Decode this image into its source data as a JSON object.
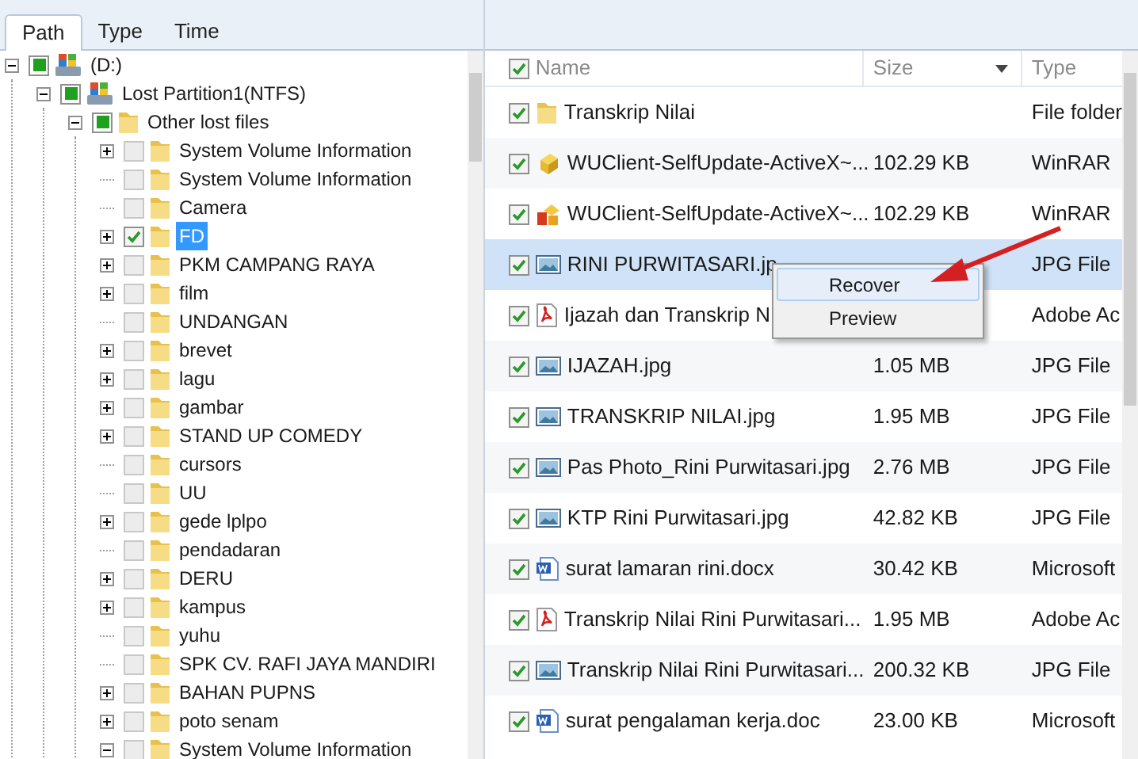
{
  "tabs": [
    {
      "label": "Path",
      "selected": true
    },
    {
      "label": "Type",
      "selected": false
    },
    {
      "label": "Time",
      "selected": false
    }
  ],
  "tree": [
    {
      "label": "(D:)",
      "kind": "drive",
      "expandable": true,
      "expanded": true,
      "partial": true,
      "selected": false,
      "children": [
        {
          "label": "Lost Partition1(NTFS)",
          "kind": "drive",
          "expandable": true,
          "expanded": true,
          "partial": true,
          "selected": false,
          "children": [
            {
              "label": "Other lost files",
              "kind": "folder",
              "expandable": true,
              "expanded": true,
              "partial": true,
              "selected": false,
              "children": [
                {
                  "label": "System Volume Information",
                  "kind": "folder",
                  "expandable": true,
                  "expanded": false,
                  "checked": false,
                  "selected": false
                },
                {
                  "label": "System Volume Information",
                  "kind": "folder",
                  "expandable": false,
                  "checked": false,
                  "selected": false
                },
                {
                  "label": "Camera",
                  "kind": "folder",
                  "expandable": false,
                  "checked": false,
                  "selected": false
                },
                {
                  "label": "FD",
                  "kind": "folder",
                  "expandable": true,
                  "expanded": false,
                  "checked": true,
                  "selected": true
                },
                {
                  "label": "PKM CAMPANG RAYA",
                  "kind": "folder",
                  "expandable": true,
                  "expanded": false,
                  "checked": false,
                  "selected": false
                },
                {
                  "label": "film",
                  "kind": "folder",
                  "expandable": true,
                  "expanded": false,
                  "checked": false,
                  "selected": false
                },
                {
                  "label": "UNDANGAN",
                  "kind": "folder",
                  "expandable": false,
                  "checked": false,
                  "selected": false
                },
                {
                  "label": "brevet",
                  "kind": "folder",
                  "expandable": true,
                  "expanded": false,
                  "checked": false,
                  "selected": false
                },
                {
                  "label": "lagu",
                  "kind": "folder",
                  "expandable": true,
                  "expanded": false,
                  "checked": false,
                  "selected": false
                },
                {
                  "label": "gambar",
                  "kind": "folder",
                  "expandable": true,
                  "expanded": false,
                  "checked": false,
                  "selected": false
                },
                {
                  "label": "STAND UP COMEDY",
                  "kind": "folder",
                  "expandable": true,
                  "expanded": false,
                  "checked": false,
                  "selected": false
                },
                {
                  "label": "cursors",
                  "kind": "folder",
                  "expandable": false,
                  "checked": false,
                  "selected": false
                },
                {
                  "label": "UU",
                  "kind": "folder",
                  "expandable": false,
                  "checked": false,
                  "selected": false
                },
                {
                  "label": "gede lplpo",
                  "kind": "folder",
                  "expandable": true,
                  "expanded": false,
                  "checked": false,
                  "selected": false
                },
                {
                  "label": "pendadaran",
                  "kind": "folder",
                  "expandable": false,
                  "checked": false,
                  "selected": false
                },
                {
                  "label": "DERU",
                  "kind": "folder",
                  "expandable": true,
                  "expanded": false,
                  "checked": false,
                  "selected": false
                },
                {
                  "label": "kampus",
                  "kind": "folder",
                  "expandable": true,
                  "expanded": false,
                  "checked": false,
                  "selected": false
                },
                {
                  "label": "yuhu",
                  "kind": "folder",
                  "expandable": false,
                  "checked": false,
                  "selected": false
                },
                {
                  "label": "SPK CV. RAFI JAYA MANDIRI",
                  "kind": "folder",
                  "expandable": false,
                  "checked": false,
                  "selected": false
                },
                {
                  "label": "BAHAN PUPNS",
                  "kind": "folder",
                  "expandable": true,
                  "expanded": false,
                  "checked": false,
                  "selected": false
                },
                {
                  "label": "poto senam",
                  "kind": "folder",
                  "expandable": true,
                  "expanded": false,
                  "checked": false,
                  "selected": false
                },
                {
                  "label": "System Volume Information",
                  "kind": "folder",
                  "expandable": true,
                  "expanded": true,
                  "checked": false,
                  "selected": false
                }
              ]
            }
          ]
        }
      ]
    }
  ],
  "table": {
    "header_checked": true,
    "columns": [
      "Name",
      "Size",
      "Type"
    ],
    "rows": [
      {
        "name": "Transkrip Nilai",
        "type": "File folder",
        "kind": "folder",
        "checked": true,
        "selected": false
      },
      {
        "name": "WUClient-SelfUpdate-ActiveX~...",
        "size": "102.29 KB",
        "type": "WinRAR",
        "kind": "package",
        "checked": true,
        "selected": false
      },
      {
        "name": "WUClient-SelfUpdate-ActiveX~...",
        "size": "102.29 KB",
        "type": "WinRAR",
        "kind": "installer",
        "checked": true,
        "selected": false
      },
      {
        "name": "RINI PURWITASARI.jp",
        "type": "JPG File",
        "kind": "image",
        "checked": true,
        "selected": true
      },
      {
        "name": "Ijazah dan Transkrip N",
        "type": "Adobe Ac",
        "kind": "pdf",
        "checked": true,
        "selected": false
      },
      {
        "name": "IJAZAH.jpg",
        "size": "1.05 MB",
        "type": "JPG File",
        "kind": "image",
        "checked": true,
        "selected": false
      },
      {
        "name": "TRANSKRIP NILAI.jpg",
        "size": "1.95 MB",
        "type": "JPG File",
        "kind": "image",
        "checked": true,
        "selected": false
      },
      {
        "name": "Pas Photo_Rini Purwitasari.jpg",
        "size": "2.76 MB",
        "type": "JPG File",
        "kind": "image",
        "checked": true,
        "selected": false
      },
      {
        "name": "KTP Rini Purwitasari.jpg",
        "size": "42.82 KB",
        "type": "JPG File",
        "kind": "image",
        "checked": true,
        "selected": false
      },
      {
        "name": "surat lamaran rini.docx",
        "size": "30.42 KB",
        "type": "Microsoft",
        "kind": "word",
        "checked": true,
        "selected": false
      },
      {
        "name": "Transkrip Nilai Rini Purwitasari...",
        "size": "1.95 MB",
        "type": "Adobe Ac",
        "kind": "pdf",
        "checked": true,
        "selected": false
      },
      {
        "name": "Transkrip Nilai Rini Purwitasari...",
        "size": "200.32 KB",
        "type": "JPG File",
        "kind": "image",
        "checked": true,
        "selected": false
      },
      {
        "name": "surat pengalaman kerja.doc",
        "size": "23.00 KB",
        "type": "Microsoft",
        "kind": "word",
        "checked": true,
        "selected": false
      }
    ]
  },
  "context_menu": {
    "items": [
      {
        "label": "Recover",
        "selected": true
      },
      {
        "label": "Preview",
        "selected": false
      }
    ]
  }
}
